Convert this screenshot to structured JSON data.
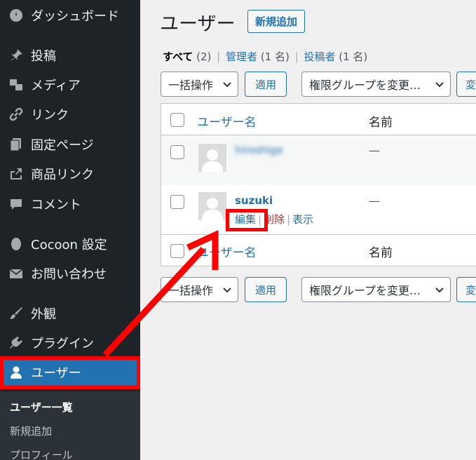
{
  "sidebar": {
    "items": [
      {
        "label": "ダッシュボード",
        "icon": "dashboard-icon"
      },
      {
        "label": "投稿",
        "icon": "pin-icon"
      },
      {
        "label": "メディア",
        "icon": "media-icon"
      },
      {
        "label": "リンク",
        "icon": "link-icon"
      },
      {
        "label": "固定ページ",
        "icon": "page-icon"
      },
      {
        "label": "商品リンク",
        "icon": "share-icon"
      },
      {
        "label": "コメント",
        "icon": "comment-icon"
      },
      {
        "label": "Cocoon 設定",
        "icon": "cocoon-icon"
      },
      {
        "label": "お問い合わせ",
        "icon": "mail-icon"
      },
      {
        "label": "外観",
        "icon": "brush-icon"
      },
      {
        "label": "プラグイン",
        "icon": "plugin-icon"
      },
      {
        "label": "ユーザー",
        "icon": "user-icon"
      }
    ],
    "submenu": [
      "ユーザー一覧",
      "新規追加",
      "プロフィール"
    ]
  },
  "header": {
    "title": "ユーザー",
    "add_new": "新規追加"
  },
  "filters": {
    "all": "すべて",
    "all_count": "(2)",
    "admin": "管理者",
    "admin_count": "(1 名)",
    "author": "投稿者",
    "author_count": "(1 名)",
    "separator": "|"
  },
  "bulk": {
    "action_label": "一括操作",
    "apply": "適用",
    "role_label": "権限グループを変更…",
    "change": "変"
  },
  "table": {
    "col_username": "ユーザー名",
    "col_name": "名前",
    "rows": [
      {
        "username": "hiroshige",
        "name": "—"
      },
      {
        "username": "suzuki",
        "name": "—"
      }
    ],
    "actions": {
      "edit": "編集",
      "delete": "削除",
      "view": "表示"
    }
  },
  "colors": {
    "sidebar_bg": "#1d2327",
    "accent": "#2271b1",
    "highlight": "#ff0000"
  }
}
